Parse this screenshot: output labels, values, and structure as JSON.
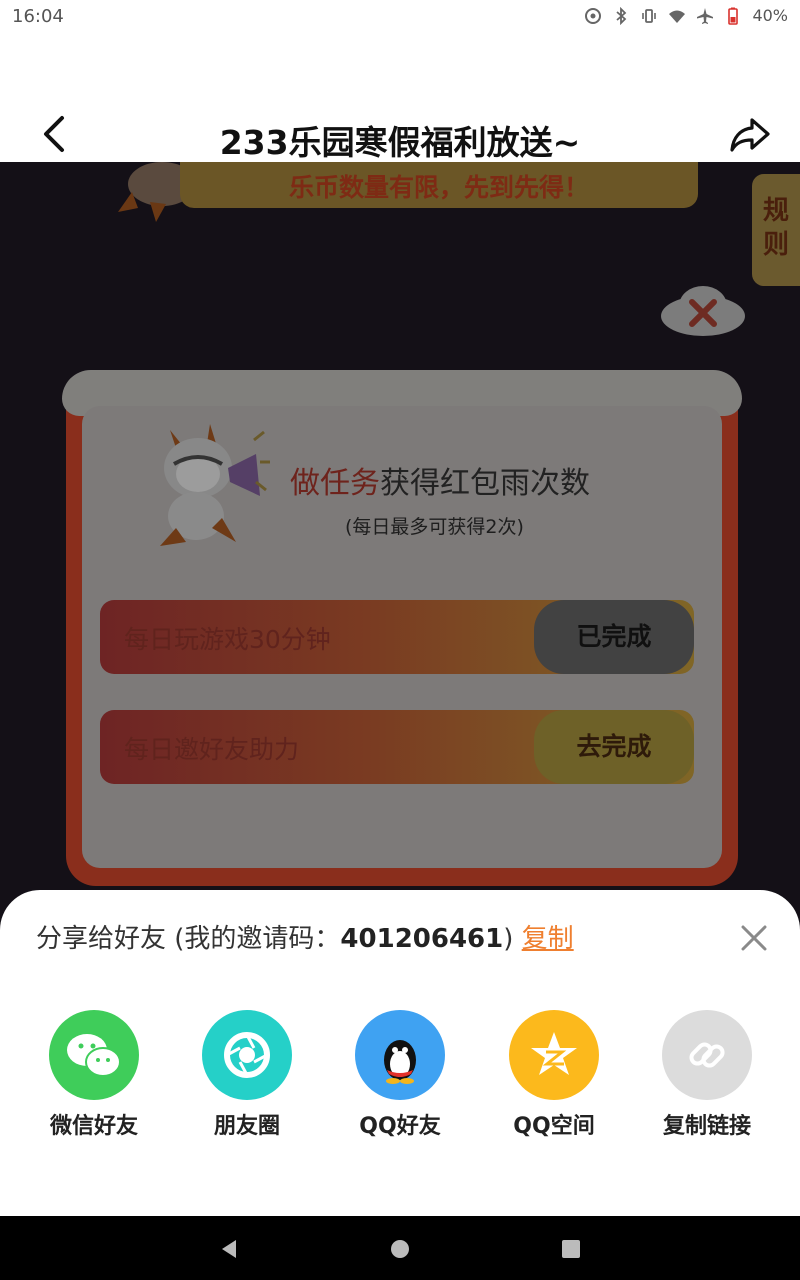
{
  "status_bar": {
    "time": "16:04",
    "battery": "40%"
  },
  "header": {
    "title": "233乐园寒假福利放送~"
  },
  "game": {
    "banner_text": "乐币数量有限，先到先得！",
    "rules_label": "规则"
  },
  "modal": {
    "heading_highlight": "做任务",
    "heading_rest": "获得红包雨次数",
    "subtitle": "(每日最多可获得2次)",
    "tasks": [
      {
        "label": "每日玩游戏30分钟",
        "button": "已完成"
      },
      {
        "label": "每日邀好友助力",
        "button": "去完成"
      }
    ]
  },
  "share_sheet": {
    "title_prefix": "分享给好友 (我的邀请码：",
    "invite_code": "401206461",
    "title_suffix": ")",
    "copy_label": "复制",
    "options": [
      {
        "label": "微信好友",
        "icon": "wechat-icon",
        "color": "#3fcd5a"
      },
      {
        "label": "朋友圈",
        "icon": "moments-icon",
        "color": "#25d0c8"
      },
      {
        "label": "QQ好友",
        "icon": "qq-icon",
        "color": "#3fa2f2"
      },
      {
        "label": "QQ空间",
        "icon": "qzone-icon",
        "color": "#fcb91c"
      },
      {
        "label": "复制链接",
        "icon": "link-icon",
        "color": "#dcdcdc"
      }
    ]
  }
}
